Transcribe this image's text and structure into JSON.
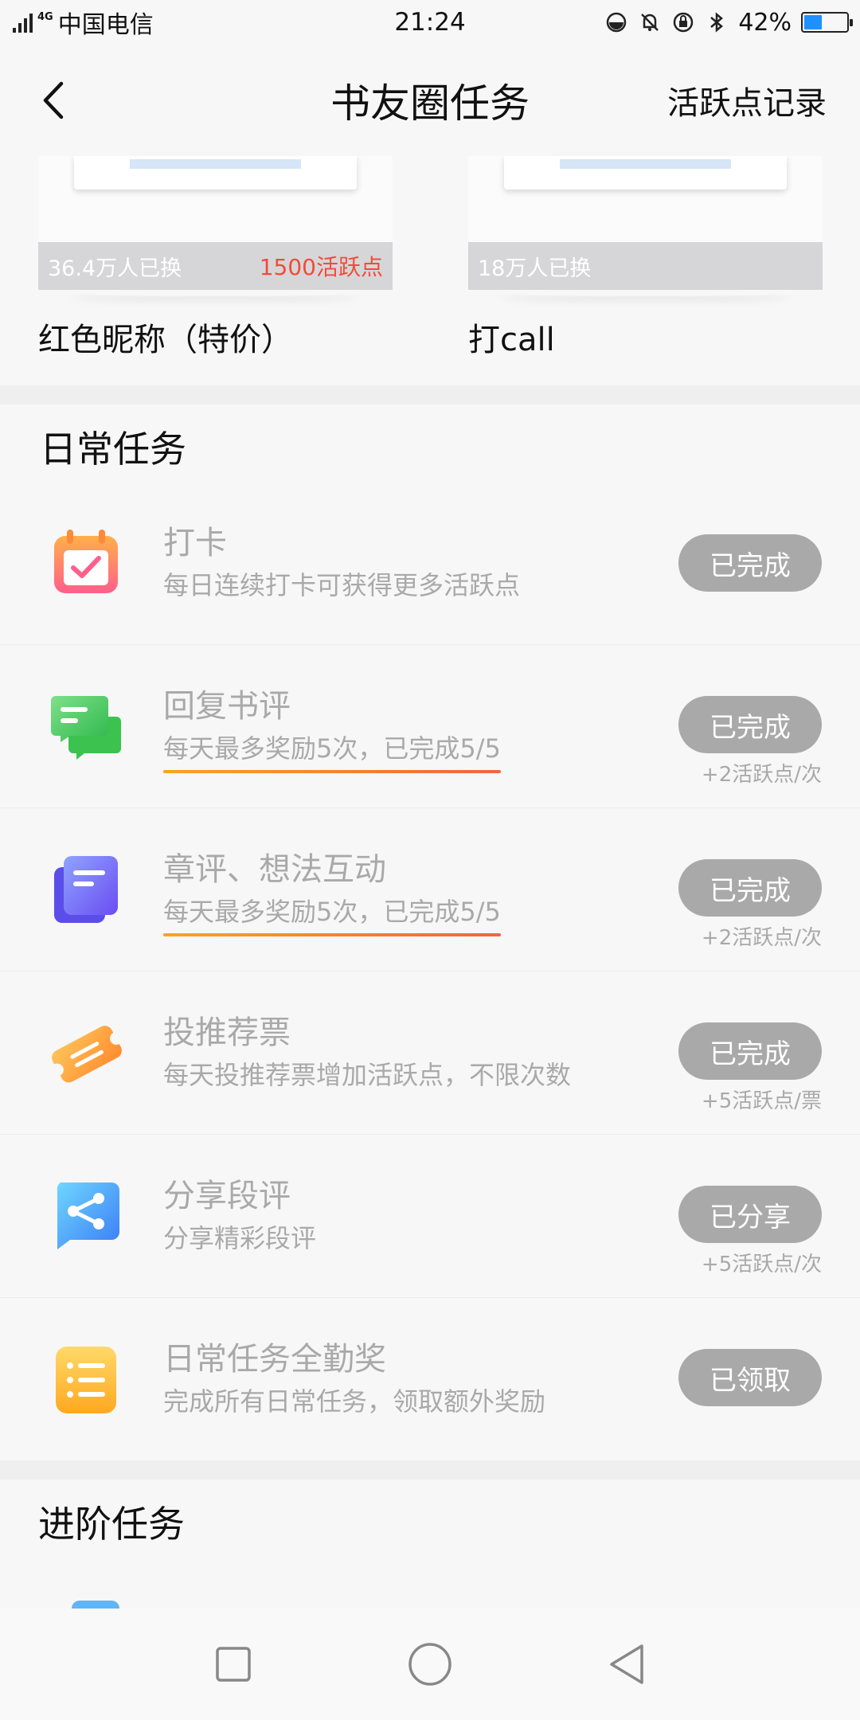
{
  "status_bar": {
    "net": "4G",
    "carrier": "中国电信",
    "time": "21:24",
    "battery": "42%",
    "battery_level": 0.42
  },
  "header": {
    "back_icon": "chevron-left-icon",
    "title": "书友圈任务",
    "right_link": "活跃点记录"
  },
  "rewards": [
    {
      "exchanged": "36.4万人已换",
      "points": "1500活跃点",
      "name": "红色昵称（特价）"
    },
    {
      "exchanged": "18万人已换",
      "points": "",
      "name": "打call"
    }
  ],
  "daily": {
    "heading": "日常任务",
    "tasks": [
      {
        "icon": "calendar-check-icon",
        "title": "打卡",
        "desc": "每日连续打卡可获得更多活跃点",
        "button": "已完成",
        "note": "",
        "underline": false
      },
      {
        "icon": "chat-bubbles-icon",
        "title": "回复书评",
        "desc": "每天最多奖励5次，已完成5/5",
        "button": "已完成",
        "note": "+2活跃点/次",
        "underline": true
      },
      {
        "icon": "document-stack-icon",
        "title": "章评、想法互动",
        "desc": "每天最多奖励5次，已完成5/5",
        "button": "已完成",
        "note": "+2活跃点/次",
        "underline": true
      },
      {
        "icon": "ticket-icon",
        "title": "投推荐票",
        "desc": "每天投推荐票增加活跃点，不限次数",
        "button": "已完成",
        "note": "+5活跃点/票",
        "underline": false
      },
      {
        "icon": "share-icon",
        "title": "分享段评",
        "desc": "分享精彩段评",
        "button": "已分享",
        "note": "+5活跃点/次",
        "underline": false
      },
      {
        "icon": "list-icon",
        "title": "日常任务全勤奖",
        "desc": "完成所有日常任务，领取额外奖励",
        "button": "已领取",
        "note": "",
        "underline": false
      }
    ]
  },
  "advanced": {
    "heading": "进阶任务"
  },
  "system_nav": {
    "recent": "square-icon",
    "home": "circle-icon",
    "back": "triangle-back-icon"
  }
}
